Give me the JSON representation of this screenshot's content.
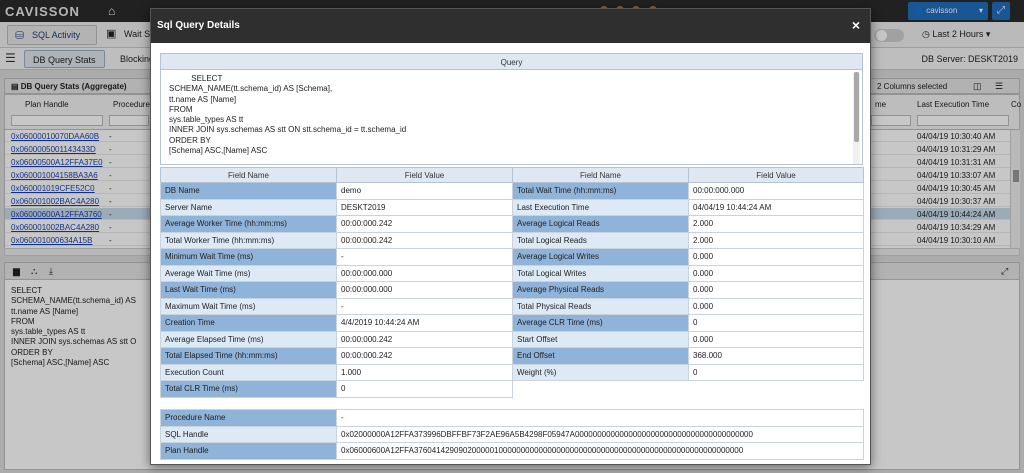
{
  "app": {
    "logo": "CAVISSON",
    "user": "cavisson",
    "toolbar": {
      "sql_activity": "SQL Activity",
      "wait": "Wait S",
      "time_range": "Last 2 Hours"
    },
    "tabs": [
      {
        "label": "DB Query Stats"
      },
      {
        "label": "Blocking"
      }
    ],
    "db_server": "DB Server: DESKT2019",
    "panel_title": "DB Query Stats (Aggregate)",
    "columns_selected": "2 Columns selected",
    "grid_headers": {
      "plan_handle": "Plan Handle",
      "procedure": "Procedure",
      "me": "me",
      "last_exec": "Last Execution Time",
      "co": "Co"
    },
    "rows": [
      {
        "handle": "0x06000010070DAA60B",
        "proc": "-",
        "time": "04/04/19 10:30:40 AM"
      },
      {
        "handle": "0x0600005001143433D",
        "proc": "-",
        "time": "04/04/19 10:31:29 AM"
      },
      {
        "handle": "0x06000500A12FFA37E0",
        "proc": "-",
        "time": "04/04/19 10:31:31 AM"
      },
      {
        "handle": "0x060001004158BA3A6",
        "proc": "-",
        "time": "04/04/19 10:33:07 AM"
      },
      {
        "handle": "0x060001019CFE52C0",
        "proc": "-",
        "time": "04/04/19 10:30:45 AM"
      },
      {
        "handle": "0x060001002BAC4A280",
        "proc": "-",
        "time": "04/04/19 10:30:37 AM"
      },
      {
        "handle": "0x06000600A12FFA3760",
        "proc": "-",
        "time": "04/04/19 10:44:24 AM"
      },
      {
        "handle": "0x060001002BAC4A280",
        "proc": "-",
        "time": "04/04/19 10:34:29 AM"
      },
      {
        "handle": "0x060001000634A15B",
        "proc": "-",
        "time": "04/04/19 10:30:10 AM"
      }
    ],
    "lower_query": "SELECT\nSCHEMA_NAME(tt.schema_id) AS\ntt.name AS [Name]\nFROM\nsys.table_types AS tt\nINNER JOIN sys.schemas AS stt O\nORDER BY\n[Schema] ASC,[Name] ASC"
  },
  "modal": {
    "title": "Sql Query Details",
    "close": "×",
    "query_header": "Query",
    "query_text": "          SELECT\nSCHEMA_NAME(tt.schema_id) AS [Schema],\ntt.name AS [Name]\nFROM\nsys.table_types AS tt\nINNER JOIN sys.schemas AS stt ON stt.schema_id = tt.schema_id\nORDER BY\n[Schema] ASC,[Name] ASC",
    "col_field_name": "Field Name",
    "col_field_value": "Field Value",
    "left_fields": [
      {
        "name": "DB Name",
        "value": "demo"
      },
      {
        "name": "Server Name",
        "value": "DESKT2019"
      },
      {
        "name": "Average Worker Time (hh:mm:ms)",
        "value": "00:00:000.242"
      },
      {
        "name": "Total Worker Time (hh:mm:ms)",
        "value": "00:00:000.242"
      },
      {
        "name": "Minimum Wait Time (ms)",
        "value": "-"
      },
      {
        "name": "Average Wait Time (ms)",
        "value": "00:00:000.000"
      },
      {
        "name": "Last Wait Time (ms)",
        "value": "00:00:000.000"
      },
      {
        "name": "Maximum Wait Time (ms)",
        "value": "-"
      },
      {
        "name": "Creation Time",
        "value": "4/4/2019 10:44:24 AM"
      },
      {
        "name": "Average Elapsed Time (ms)",
        "value": "00:00:000.242"
      },
      {
        "name": "Total Elapsed Time (hh:mm:ms)",
        "value": "00:00:000.242"
      },
      {
        "name": "Execution Count",
        "value": "1.000"
      },
      {
        "name": "Total CLR Time (ms)",
        "value": "0"
      }
    ],
    "right_fields": [
      {
        "name": "Total Wait Time (hh:mm:ms)",
        "value": "00:00:000.000"
      },
      {
        "name": "Last Execution Time",
        "value": "04/04/19 10:44:24 AM"
      },
      {
        "name": "Average Logical Reads",
        "value": "2.000"
      },
      {
        "name": "Total Logical Reads",
        "value": "2.000"
      },
      {
        "name": "Average Logical Writes",
        "value": "0.000"
      },
      {
        "name": "Total Logical Writes",
        "value": "0.000"
      },
      {
        "name": "Average Physical Reads",
        "value": "0.000"
      },
      {
        "name": "Total Physical Reads",
        "value": "0.000"
      },
      {
        "name": "Average CLR Time (ms)",
        "value": "0"
      },
      {
        "name": "Start Offset",
        "value": "0.000"
      },
      {
        "name": "End Offset",
        "value": "368.000"
      },
      {
        "name": "Weight (%)",
        "value": "0"
      }
    ],
    "bottom_fields": [
      {
        "name": "Procedure Name",
        "value": "-"
      },
      {
        "name": "SQL Handle",
        "value": "0x02000000A12FFA373996DBFFBF73F2AE96A5B4298F05947A0000000000000000000000000000000000000000"
      },
      {
        "name": "Plan Handle",
        "value": "0x06000600A12FFA37604142909020000010000000000000000000000000000000000000000000000000000000"
      }
    ]
  }
}
